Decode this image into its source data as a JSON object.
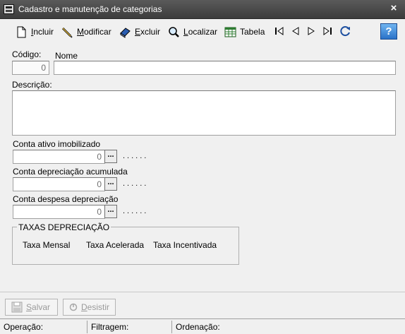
{
  "window": {
    "title": "Cadastro e manutenção de categorias"
  },
  "toolbar": {
    "incluir": "Incluir",
    "modificar": "Modificar",
    "excluir": "Excluir",
    "localizar": "Localizar",
    "tabela": "Tabela"
  },
  "form": {
    "codigo_label": "Código:",
    "codigo_value": "0",
    "nome_label": "Nome",
    "nome_value": "",
    "descricao_label": "Descrição:",
    "descricao_value": "",
    "conta_ativo_label": "Conta ativo imobilizado",
    "conta_ativo_value": "0",
    "conta_depr_label": "Conta depreciação acumulada",
    "conta_depr_value": "0",
    "conta_desp_label": "Conta despesa depreciação",
    "conta_desp_value": "0",
    "lookup_label": "...",
    "dots": "......"
  },
  "taxas": {
    "title": "TAXAS DEPRECIAÇÃO",
    "mensal": "Taxa Mensal",
    "acelerada": "Taxa Acelerada",
    "incentivada": "Taxa Incentivada"
  },
  "actions": {
    "salvar": "Salvar",
    "desistir": "Desistir"
  },
  "status": {
    "operacao": "Operação:",
    "filtragem": "Filtragem:",
    "ordenacao": "Ordenação:"
  },
  "icons": {
    "help": "?",
    "close": "×"
  }
}
